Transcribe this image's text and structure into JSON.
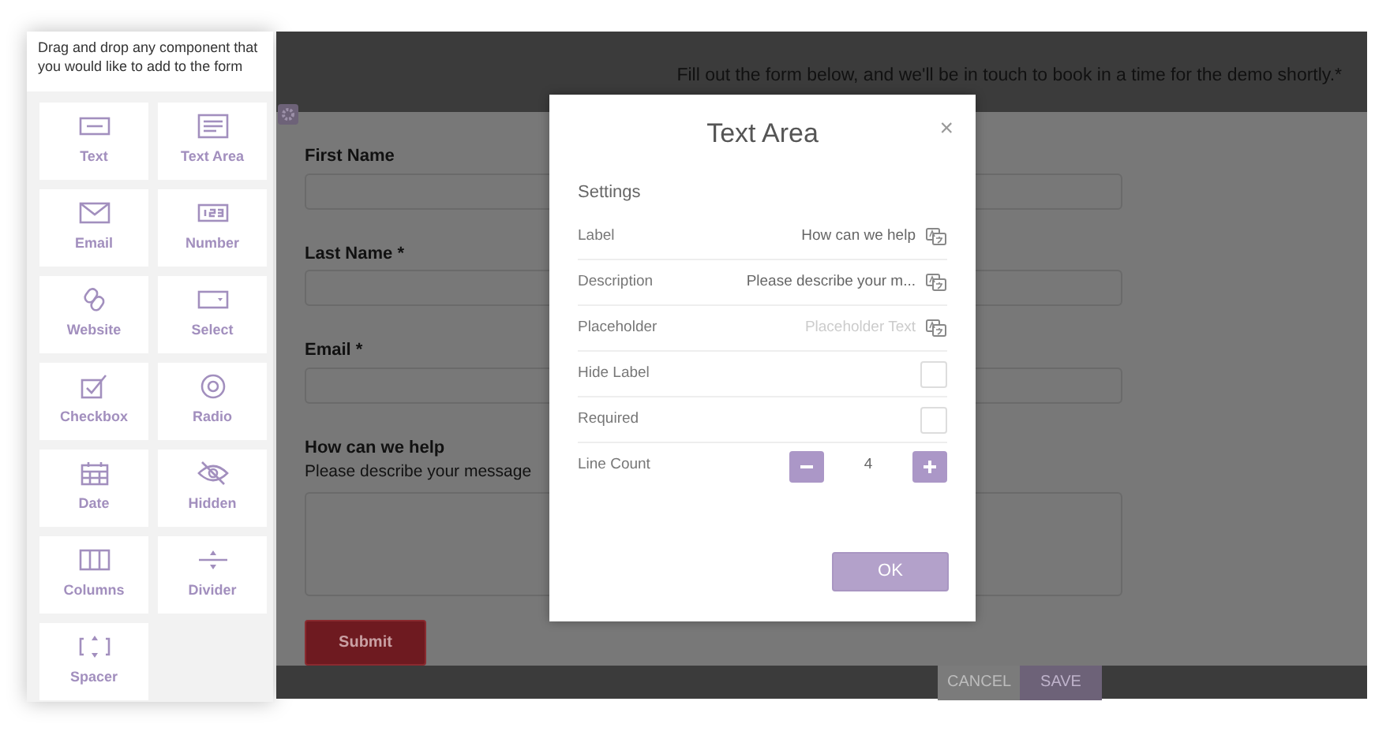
{
  "sidebar": {
    "hint": "Drag and drop any component that you would like to add to the form",
    "components": [
      {
        "kind": "text",
        "label": "Text"
      },
      {
        "kind": "textarea",
        "label": "Text Area"
      },
      {
        "kind": "email",
        "label": "Email"
      },
      {
        "kind": "number",
        "label": "Number"
      },
      {
        "kind": "website",
        "label": "Website"
      },
      {
        "kind": "select",
        "label": "Select"
      },
      {
        "kind": "checkbox",
        "label": "Checkbox"
      },
      {
        "kind": "radio",
        "label": "Radio"
      },
      {
        "kind": "date",
        "label": "Date"
      },
      {
        "kind": "hidden",
        "label": "Hidden"
      },
      {
        "kind": "columns",
        "label": "Columns"
      },
      {
        "kind": "divider",
        "label": "Divider"
      },
      {
        "kind": "spacer",
        "label": "Spacer"
      }
    ]
  },
  "form": {
    "intro": "Fill out the form below, and we'll be in touch to book in a time for the demo shortly.*",
    "fields": [
      {
        "kind": "input",
        "label": "First Name"
      },
      {
        "kind": "input",
        "label": "Last Name *"
      },
      {
        "kind": "input",
        "label": "Email *"
      },
      {
        "kind": "textarea",
        "label": "How can we help",
        "description": "Please describe your message"
      }
    ],
    "submit": "Submit"
  },
  "dialog": {
    "title": "Text Area",
    "close": "×",
    "section": "Settings",
    "rows": [
      {
        "kind": "text",
        "label": "Label",
        "value": "How can we help"
      },
      {
        "kind": "text",
        "label": "Description",
        "value": "Please describe your m..."
      },
      {
        "kind": "text",
        "label": "Placeholder",
        "placeholder": "Placeholder Text"
      },
      {
        "kind": "checkbox",
        "label": "Hide Label",
        "checked": false
      },
      {
        "kind": "checkbox",
        "label": "Required",
        "checked": false
      },
      {
        "kind": "stepper",
        "label": "Line Count",
        "value": "4"
      }
    ],
    "ok": "OK"
  },
  "footer": {
    "buttons": [
      {
        "label": "CANCEL",
        "kind": "secondary"
      },
      {
        "label": "SAVE",
        "kind": "primary"
      }
    ]
  }
}
